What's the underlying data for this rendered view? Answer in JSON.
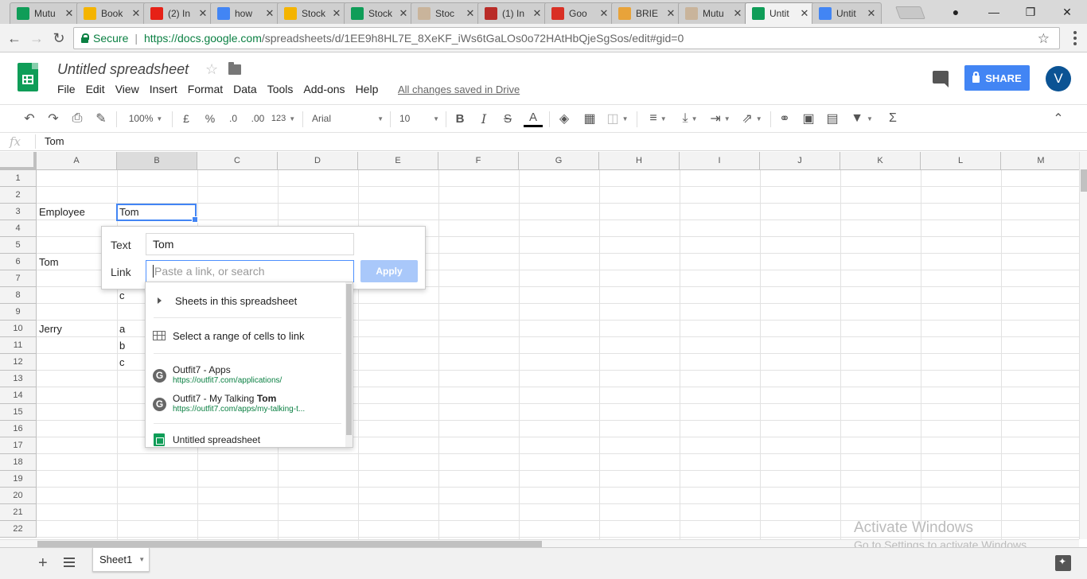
{
  "browser": {
    "tabs": [
      {
        "title": "Mutu",
        "fav": "sheets-icon",
        "color": "#0f9d58"
      },
      {
        "title": "Book",
        "fav": "drive-icon",
        "color": "#f4b400"
      },
      {
        "title": "(2) In",
        "fav": "youtube-icon",
        "color": "#e62117"
      },
      {
        "title": "how",
        "fav": "google-icon",
        "color": "#4285f4"
      },
      {
        "title": "Stock",
        "fav": "drive-icon",
        "color": "#f4b400"
      },
      {
        "title": "Stock",
        "fav": "sheets-icon",
        "color": "#0f9d58"
      },
      {
        "title": "Stoc",
        "fav": "et-icon",
        "color": "#c9b49b"
      },
      {
        "title": "(1) In",
        "fav": "quora-icon",
        "color": "#b92b27"
      },
      {
        "title": "Goo",
        "fav": "gmail-icon",
        "color": "#d93025"
      },
      {
        "title": "BRIE",
        "fav": "brie-icon",
        "color": "#e8a33a"
      },
      {
        "title": "Mutu",
        "fav": "et-icon",
        "color": "#c9b49b"
      },
      {
        "title": "Untit",
        "fav": "sheets-icon",
        "color": "#0f9d58"
      },
      {
        "title": "Untit",
        "fav": "docs-icon",
        "color": "#4285f4"
      }
    ],
    "secure_label": "Secure",
    "url_scheme_host": "https://docs.google.com",
    "url_path": "/spreadsheets/d/1EE9h8HL7E_8XeKF_iWs6tGaLOs0o72HAtHbQjeSgSos/edit#gid=0"
  },
  "doc": {
    "title": "Untitled spreadsheet",
    "menus": [
      "File",
      "Edit",
      "View",
      "Insert",
      "Format",
      "Data",
      "Tools",
      "Add-ons",
      "Help"
    ],
    "saved_msg": "All changes saved in Drive",
    "share_label": "SHARE",
    "avatar_letter": "V"
  },
  "toolbar": {
    "zoom": "100%",
    "currency": "£",
    "percent": "%",
    "dec_less": ".0",
    "dec_more": ".00",
    "more_formats": "123",
    "font": "Arial",
    "font_size": "10",
    "bold": "B",
    "italic": "I",
    "strike": "S",
    "text_color": "A",
    "sum": "Σ"
  },
  "formula": {
    "fx": "fx",
    "value": "Tom"
  },
  "grid": {
    "columns": [
      "A",
      "B",
      "C",
      "D",
      "E",
      "F",
      "G",
      "H",
      "I",
      "J",
      "K",
      "L",
      "M"
    ],
    "rows": [
      "1",
      "2",
      "3",
      "4",
      "5",
      "6",
      "7",
      "8",
      "9",
      "10",
      "11",
      "12",
      "13",
      "14",
      "15",
      "16",
      "17",
      "18",
      "19",
      "20",
      "21",
      "22"
    ],
    "cells": {
      "A3": "Employee",
      "B3": "Tom",
      "A6": "Tom",
      "B8": "c",
      "A10": "Jerry",
      "B10": "a",
      "B11": "b",
      "B12": "c"
    }
  },
  "link_dialog": {
    "text_label": "Text",
    "text_value": "Tom",
    "link_label": "Link",
    "link_placeholder": "Paste a link, or search",
    "apply_label": "Apply"
  },
  "suggestions": {
    "sheets_item": "Sheets in this spreadsheet",
    "range_item": "Select a range of cells to link",
    "results": [
      {
        "title": "Outfit7 - Apps",
        "url": "https://outfit7.com/applications/"
      },
      {
        "title_prefix": "Outfit7 - My Talking ",
        "title_bold": "Tom",
        "url": "https://outfit7.com/apps/my-talking-t..."
      }
    ],
    "doc_item": "Untitled spreadsheet"
  },
  "sheets": {
    "active": "Sheet1"
  },
  "watermark": {
    "line1": "Activate Windows",
    "line2": "Go to Settings to activate Windows."
  }
}
